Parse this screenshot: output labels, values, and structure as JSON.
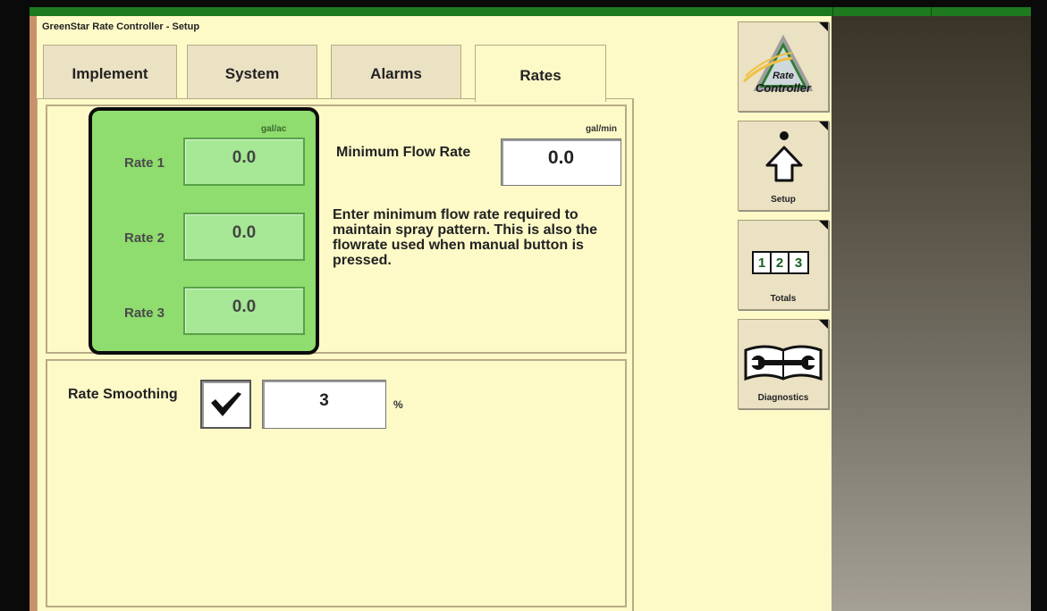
{
  "app_title": "GreenStar Rate Controller - Setup",
  "tabs": [
    {
      "label": "Implement"
    },
    {
      "label": "System"
    },
    {
      "label": "Alarms"
    },
    {
      "label": "Rates"
    }
  ],
  "rates": {
    "unit": "gal/ac",
    "items": [
      {
        "label": "Rate 1",
        "value": "0.0"
      },
      {
        "label": "Rate 2",
        "value": "0.0"
      },
      {
        "label": "Rate 3",
        "value": "0.0"
      }
    ]
  },
  "minimum_flow": {
    "label": "Minimum Flow Rate",
    "unit": "gal/min",
    "value": "0.0",
    "help": "Enter minimum flow rate required to maintain spray pattern.  This is also the flowrate used when manual button is pressed."
  },
  "rate_smoothing": {
    "label": "Rate Smoothing",
    "checked": true,
    "value": "3",
    "unit": "%"
  },
  "sidebar": {
    "buttons": [
      {
        "label": "",
        "logo_text": "Rate Controller",
        "icon": "rate-controller-logo-icon"
      },
      {
        "label": "Setup",
        "icon": "setup-arrow-icon"
      },
      {
        "label": "Totals",
        "icon": "totals-123-icon",
        "digits": [
          "1",
          "2",
          "3"
        ]
      },
      {
        "label": "Diagnostics",
        "icon": "wrench-book-icon"
      }
    ]
  },
  "colors": {
    "screen_bg": "#fdfac8",
    "rates_box": "#8fdc6f",
    "top_bar": "#1f7a1f"
  }
}
